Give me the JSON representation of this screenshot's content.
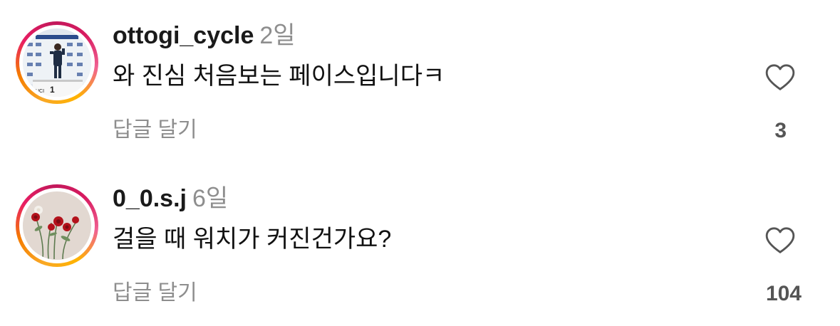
{
  "comments": [
    {
      "username": "ottogi_cycle",
      "time": "2일",
      "text": "와 진심 처음보는 페이스입니다ㅋ",
      "reply_label": "답글 달기",
      "likes": "3",
      "avatar_desc_icon": "cyclist-podium-avatar"
    },
    {
      "username": "0_0.s.j",
      "time": "6일",
      "text": "걸을 때 워치가 커진건가요?",
      "reply_label": "답글 달기",
      "likes": "104",
      "avatar_desc_icon": "flowers-avatar"
    }
  ],
  "colors": {
    "text_primary": "#111111",
    "text_secondary": "#8e8e8e",
    "like_count": "#555555",
    "story_ring_start": "#f9a825",
    "story_ring_mid": "#e91e63"
  },
  "icons": {
    "like": "heart-outline-icon"
  }
}
